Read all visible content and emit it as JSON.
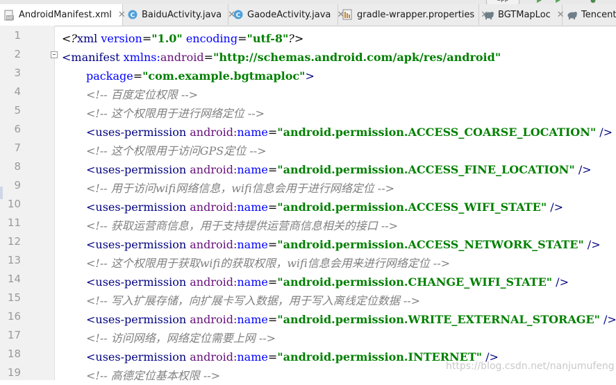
{
  "toolbar": {
    "run_config": "app"
  },
  "tabs": [
    {
      "label": "AndroidManifest.xml",
      "icon": "xml-manifest-icon",
      "active": true
    },
    {
      "label": "BaiduActivity.java",
      "icon": "java-class-icon",
      "active": false
    },
    {
      "label": "GaodeActivity.java",
      "icon": "java-class-icon",
      "active": false
    },
    {
      "label": "gradle-wrapper.properties",
      "icon": "properties-file-icon",
      "active": false
    },
    {
      "label": "BGTMapLoc",
      "icon": "gradle-elephant-icon",
      "active": false
    },
    {
      "label": "Tencent",
      "icon": "gradle-elephant-icon",
      "active": false
    }
  ],
  "colors": {
    "tag": "#000080",
    "attribute": "#0000ff",
    "namespace": "#660e7a",
    "value": "#008000",
    "comment": "#808080",
    "gutter_bg": "#f1f1f1",
    "tab_bg": "#ececec"
  },
  "code": {
    "lines": [
      {
        "n": "1",
        "parts": [
          {
            "c": "t-pi",
            "t": "<?"
          },
          {
            "c": "t-tag",
            "t": "xml"
          },
          {
            "c": "t-plain",
            "t": " "
          },
          {
            "c": "t-attr",
            "t": "version"
          },
          {
            "c": "t-plain",
            "t": "="
          },
          {
            "c": "t-val",
            "t": "\"1.0\""
          },
          {
            "c": "t-plain",
            "t": " "
          },
          {
            "c": "t-attr",
            "t": "encoding"
          },
          {
            "c": "t-plain",
            "t": "="
          },
          {
            "c": "t-val",
            "t": "\"utf-8\""
          },
          {
            "c": "t-pi",
            "t": "?>"
          }
        ]
      },
      {
        "n": "2",
        "parts": [
          {
            "c": "t-tag",
            "t": "<manifest"
          },
          {
            "c": "t-plain",
            "t": " "
          },
          {
            "c": "t-attr",
            "t": "xmlns:"
          },
          {
            "c": "t-ns",
            "t": "android"
          },
          {
            "c": "t-plain",
            "t": "="
          },
          {
            "c": "t-val",
            "t": "\"http://schemas.android.com/apk/res/android\""
          }
        ]
      },
      {
        "n": "3",
        "parts": [
          {
            "c": "ind",
            "t": ""
          },
          {
            "c": "t-attr",
            "t": "package"
          },
          {
            "c": "t-plain",
            "t": "="
          },
          {
            "c": "t-val",
            "t": "\"com.example.bgtmaploc\""
          },
          {
            "c": "t-tag",
            "t": ">"
          }
        ]
      },
      {
        "n": "4",
        "parts": [
          {
            "c": "ind",
            "t": ""
          },
          {
            "c": "t-com",
            "t": "<!-- 百度定位权限 -->"
          }
        ]
      },
      {
        "n": "5",
        "parts": [
          {
            "c": "ind",
            "t": ""
          },
          {
            "c": "t-com",
            "t": "<!-- 这个权限用于进行网络定位 -->"
          }
        ]
      },
      {
        "n": "6",
        "parts": [
          {
            "c": "ind",
            "t": ""
          },
          {
            "c": "t-tag",
            "t": "<uses-permission"
          },
          {
            "c": "t-plain",
            "t": " "
          },
          {
            "c": "t-ns",
            "t": "android:"
          },
          {
            "c": "t-attr",
            "t": "name"
          },
          {
            "c": "t-plain",
            "t": "="
          },
          {
            "c": "t-val",
            "t": "\"android.permission.ACCESS_COARSE_LOCATION\""
          },
          {
            "c": "t-tag",
            "t": " />"
          }
        ]
      },
      {
        "n": "7",
        "parts": [
          {
            "c": "ind",
            "t": ""
          },
          {
            "c": "t-com",
            "t": "<!-- 这个权限用于访问GPS定位 -->"
          }
        ]
      },
      {
        "n": "8",
        "parts": [
          {
            "c": "ind",
            "t": ""
          },
          {
            "c": "t-tag",
            "t": "<uses-permission"
          },
          {
            "c": "t-plain",
            "t": " "
          },
          {
            "c": "t-ns",
            "t": "android:"
          },
          {
            "c": "t-attr",
            "t": "name"
          },
          {
            "c": "t-plain",
            "t": "="
          },
          {
            "c": "t-val",
            "t": "\"android.permission.ACCESS_FINE_LOCATION\""
          },
          {
            "c": "t-tag",
            "t": " />"
          }
        ]
      },
      {
        "n": "9",
        "parts": [
          {
            "c": "ind",
            "t": ""
          },
          {
            "c": "t-com",
            "t": "<!-- 用于访问wifi网络信息，wifi信息会用于进行网络定位 -->"
          }
        ]
      },
      {
        "n": "10",
        "parts": [
          {
            "c": "ind",
            "t": ""
          },
          {
            "c": "t-tag",
            "t": "<uses-permission"
          },
          {
            "c": "t-plain",
            "t": " "
          },
          {
            "c": "t-ns",
            "t": "android:"
          },
          {
            "c": "t-attr",
            "t": "name"
          },
          {
            "c": "t-plain",
            "t": "="
          },
          {
            "c": "t-val",
            "t": "\"android.permission.ACCESS_WIFI_STATE\""
          },
          {
            "c": "t-tag",
            "t": " />"
          }
        ]
      },
      {
        "n": "11",
        "parts": [
          {
            "c": "ind",
            "t": ""
          },
          {
            "c": "t-com",
            "t": "<!-- 获取运营商信息，用于支持提供运营商信息相关的接口 -->"
          }
        ]
      },
      {
        "n": "12",
        "parts": [
          {
            "c": "ind",
            "t": ""
          },
          {
            "c": "t-tag",
            "t": "<uses-permission"
          },
          {
            "c": "t-plain",
            "t": " "
          },
          {
            "c": "t-ns",
            "t": "android:"
          },
          {
            "c": "t-attr",
            "t": "name"
          },
          {
            "c": "t-plain",
            "t": "="
          },
          {
            "c": "t-val",
            "t": "\"android.permission.ACCESS_NETWORK_STATE\""
          },
          {
            "c": "t-tag",
            "t": " />"
          }
        ]
      },
      {
        "n": "13",
        "parts": [
          {
            "c": "ind",
            "t": ""
          },
          {
            "c": "t-com",
            "t": "<!-- 这个权限用于获取wifi的获取权限，wifi信息会用来进行网络定位 -->"
          }
        ]
      },
      {
        "n": "14",
        "parts": [
          {
            "c": "ind",
            "t": ""
          },
          {
            "c": "t-tag",
            "t": "<uses-permission"
          },
          {
            "c": "t-plain",
            "t": " "
          },
          {
            "c": "t-ns",
            "t": "android:"
          },
          {
            "c": "t-attr",
            "t": "name"
          },
          {
            "c": "t-plain",
            "t": "="
          },
          {
            "c": "t-val",
            "t": "\"android.permission.CHANGE_WIFI_STATE\""
          },
          {
            "c": "t-tag",
            "t": " />"
          }
        ]
      },
      {
        "n": "15",
        "parts": [
          {
            "c": "ind",
            "t": ""
          },
          {
            "c": "t-com",
            "t": "<!-- 写入扩展存储，向扩展卡写入数据，用于写入离线定位数据 -->"
          }
        ]
      },
      {
        "n": "16",
        "parts": [
          {
            "c": "ind",
            "t": ""
          },
          {
            "c": "t-tag",
            "t": "<uses-permission"
          },
          {
            "c": "t-plain",
            "t": " "
          },
          {
            "c": "t-ns",
            "t": "android:"
          },
          {
            "c": "t-attr",
            "t": "name"
          },
          {
            "c": "t-plain",
            "t": "="
          },
          {
            "c": "t-val",
            "t": "\"android.permission.WRITE_EXTERNAL_STORAGE\""
          },
          {
            "c": "t-tag",
            "t": " />"
          }
        ]
      },
      {
        "n": "17",
        "parts": [
          {
            "c": "ind",
            "t": ""
          },
          {
            "c": "t-com",
            "t": "<!-- 访问网络，网络定位需要上网 -->"
          }
        ]
      },
      {
        "n": "18",
        "parts": [
          {
            "c": "ind",
            "t": ""
          },
          {
            "c": "t-tag",
            "t": "<uses-permission"
          },
          {
            "c": "t-plain",
            "t": " "
          },
          {
            "c": "t-ns",
            "t": "android:"
          },
          {
            "c": "t-attr",
            "t": "name"
          },
          {
            "c": "t-plain",
            "t": "="
          },
          {
            "c": "t-val",
            "t": "\"android.permission.INTERNET\""
          },
          {
            "c": "t-tag",
            "t": " />"
          }
        ]
      },
      {
        "n": "19",
        "parts": [
          {
            "c": "ind",
            "t": ""
          },
          {
            "c": "t-com",
            "t": "<!-- 高德定位基本权限 -->"
          }
        ]
      }
    ]
  },
  "watermark": "https://blog.csdn.net/nanjumufeng"
}
